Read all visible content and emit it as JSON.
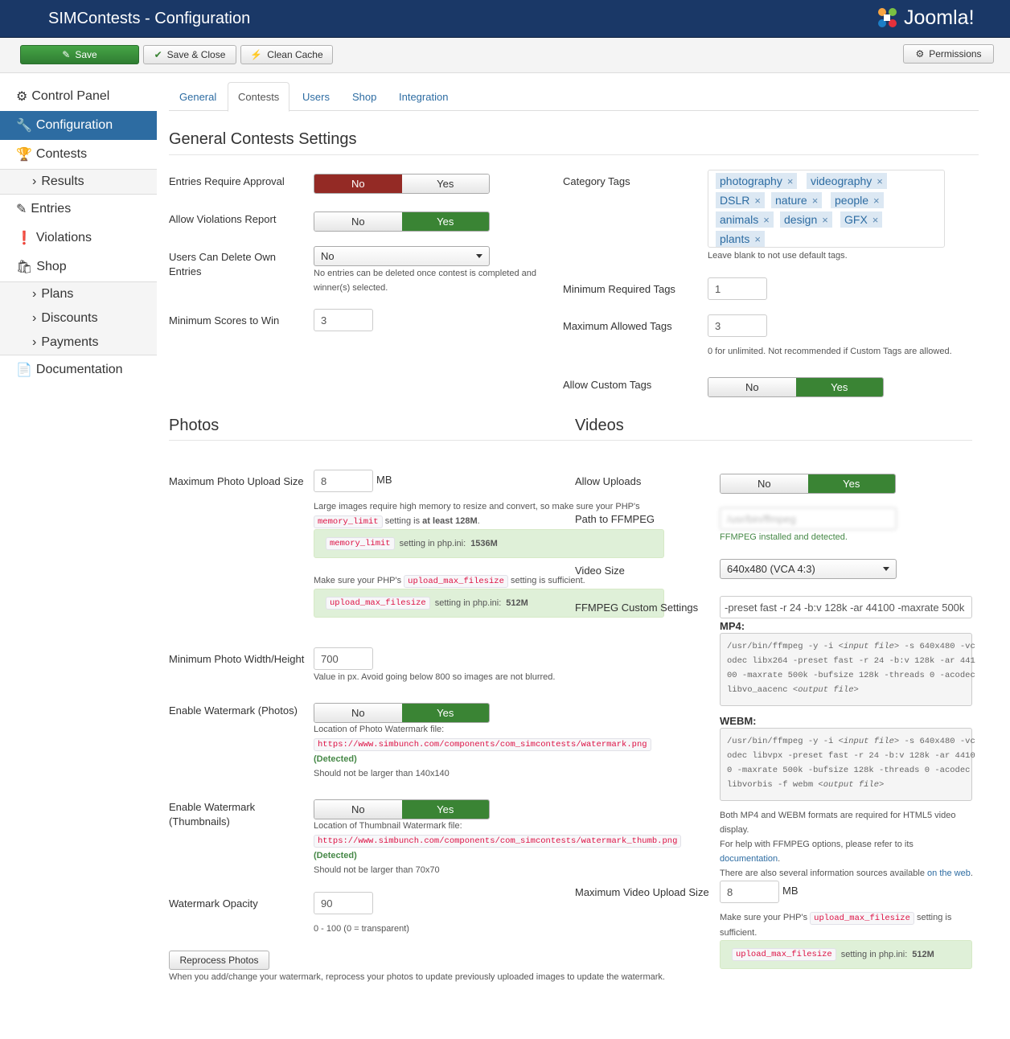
{
  "header": {
    "title": "SIMContests - Configuration",
    "brand": "Joomla!"
  },
  "toolbar": {
    "save": "Save",
    "save_close": "Save & Close",
    "clean_cache": "Clean Cache",
    "permissions": "Permissions"
  },
  "sidebar": {
    "control_panel": "Control Panel",
    "configuration": "Configuration",
    "contests": "Contests",
    "results": "Results",
    "entries": "Entries",
    "violations": "Violations",
    "shop": "Shop",
    "plans": "Plans",
    "discounts": "Discounts",
    "payments": "Payments",
    "documentation": "Documentation"
  },
  "tabs": {
    "general": "General",
    "contests": "Contests",
    "users": "Users",
    "shop": "Shop",
    "integration": "Integration"
  },
  "general": {
    "title": "General Contests Settings",
    "entries_require_approval": {
      "label": "Entries Require Approval",
      "no": "No",
      "yes": "Yes",
      "value": "No"
    },
    "allow_violations": {
      "label": "Allow Violations Report",
      "no": "No",
      "yes": "Yes",
      "value": "Yes"
    },
    "users_delete": {
      "label": "Users Can Delete Own Entries",
      "value": "No",
      "help": "No entries can be deleted once contest is completed and winner(s) selected."
    },
    "min_scores": {
      "label": "Minimum Scores to Win",
      "value": "3"
    },
    "category_tags": {
      "label": "Category Tags",
      "tags": [
        "photography",
        "videography",
        "DSLR",
        "nature",
        "people",
        "animals",
        "design",
        "GFX",
        "plants"
      ],
      "remove": "×",
      "help": "Leave blank to not use default tags."
    },
    "min_tags": {
      "label": "Minimum Required Tags",
      "value": "1"
    },
    "max_tags": {
      "label": "Maximum Allowed Tags",
      "value": "3",
      "help": "0 for unlimited. Not recommended if Custom Tags are allowed."
    },
    "custom_tags": {
      "label": "Allow Custom Tags",
      "no": "No",
      "yes": "Yes",
      "value": "Yes"
    }
  },
  "photos": {
    "title": "Photos",
    "max_upload": {
      "label": "Maximum Photo Upload Size",
      "value": "8",
      "unit": "MB",
      "help1": "Large images require high memory to resize and convert, so make sure your PHP's",
      "help1_code": "memory_limit",
      "help1_b": "setting is",
      "help1_strong": "at least 128M",
      "help1_end": ".",
      "well1_code": "memory_limit",
      "well1_text": "setting in php.ini:",
      "well1_value": "1536M",
      "help2_a": "Make sure your PHP's",
      "help2_code": "upload_max_filesize",
      "help2_b": "setting is sufficient.",
      "well2_code": "upload_max_filesize",
      "well2_text": "setting in php.ini:",
      "well2_value": "512M"
    },
    "min_wh": {
      "label": "Minimum Photo Width/Height",
      "value": "700",
      "help": "Value in px. Avoid going below 800 so images are not blurred."
    },
    "watermark_photos": {
      "label": "Enable Watermark (Photos)",
      "no": "No",
      "yes": "Yes",
      "value": "Yes",
      "loc_label": "Location of Photo Watermark file:",
      "url": "https://www.simbunch.com/components/com_simcontests/watermark.png",
      "detected": "(Detected)",
      "size": "Should not be larger than 140x140"
    },
    "watermark_thumbs": {
      "label": "Enable Watermark (Thumbnails)",
      "no": "No",
      "yes": "Yes",
      "value": "Yes",
      "loc_label": "Location of Thumbnail Watermark file:",
      "url": "https://www.simbunch.com/components/com_simcontests/watermark_thumb.png",
      "detected": "(Detected)",
      "size": "Should not be larger than 70x70"
    },
    "opacity": {
      "label": "Watermark Opacity",
      "value": "90",
      "help": "0 - 100 (0 = transparent)"
    },
    "reprocess": {
      "button": "Reprocess Photos",
      "help": "When you add/change your watermark, reprocess your photos to update previously uploaded images to update the watermark."
    }
  },
  "videos": {
    "title": "Videos",
    "allow_uploads": {
      "label": "Allow Uploads",
      "no": "No",
      "yes": "Yes",
      "value": "Yes"
    },
    "ffmpeg_path": {
      "label": "Path to FFMPEG",
      "value": "/usr/bin/ffmpeg",
      "help": "FFMPEG installed and detected."
    },
    "video_size": {
      "label": "Video Size",
      "value": "640x480 (VCA 4:3)"
    },
    "ffmpeg_custom": {
      "label": "FFMPEG Custom Settings",
      "value": "-preset fast -r 24 -b:v 128k -ar 44100 -maxrate 500k",
      "mp4_label": "MP4:",
      "mp4_lines": [
        [
          "/usr/bin/ffmpeg -y -i ",
          "<input file>",
          " -s 640x480 -vc"
        ],
        [
          "odec libx264 -preset fast -r 24 -b:v 128k -ar 441",
          "",
          ""
        ],
        [
          "00 -maxrate 500k -bufsize 128k -threads 0 -acodec",
          "",
          ""
        ],
        [
          "libvo_aacenc ",
          "<output file>",
          ""
        ]
      ],
      "webm_label": "WEBM:",
      "webm_lines": [
        [
          "/usr/bin/ffmpeg -y -i ",
          "<input file>",
          " -s 640x480 -vc"
        ],
        [
          "odec libvpx -preset fast -r 24 -b:v 128k -ar 4410",
          "",
          ""
        ],
        [
          "0 -maxrate 500k -bufsize 128k -threads 0 -acodec",
          "",
          ""
        ],
        [
          "libvorbis -f webm ",
          "<output file>",
          ""
        ]
      ],
      "note1": "Both MP4 and WEBM formats are required for HTML5 video display.",
      "note2_a": "For help with FFMPEG options, please refer to its",
      "note2_link": "documentation",
      "note2_end": ".",
      "note3_a": "There are also several information sources available",
      "note3_link": "on the web",
      "note3_end": "."
    },
    "max_upload": {
      "label": "Maximum Video Upload Size",
      "value": "8",
      "unit": "MB",
      "help_a": "Make sure your PHP's",
      "help_code": "upload_max_filesize",
      "help_b": "setting is sufficient.",
      "well_code": "upload_max_filesize",
      "well_text": "setting in php.ini:",
      "well_value": "512M"
    }
  },
  "colors": {
    "header": "#1a3867",
    "active": "#2d6ca2",
    "red": "#942a25",
    "green": "#3a8434"
  }
}
